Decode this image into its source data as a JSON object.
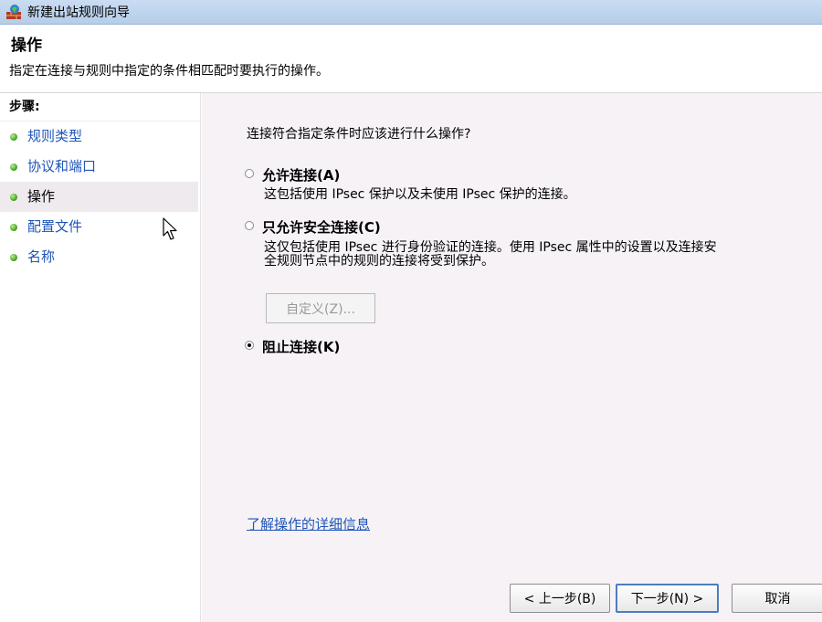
{
  "window": {
    "title": "新建出站规则向导"
  },
  "header": {
    "title": "操作",
    "subtitle": "指定在连接与规则中指定的条件相匹配时要执行的操作。"
  },
  "steps": {
    "label": "步骤:",
    "items": [
      {
        "label": "规则类型",
        "current": false
      },
      {
        "label": "协议和端口",
        "current": false
      },
      {
        "label": "操作",
        "current": true
      },
      {
        "label": "配置文件",
        "current": false
      },
      {
        "label": "名称",
        "current": false
      }
    ]
  },
  "content": {
    "question": "连接符合指定条件时应该进行什么操作?",
    "options": [
      {
        "label": "允许连接(A)",
        "desc": [
          "这包括使用 IPsec 保护以及未使用 IPsec 保护的连接。"
        ],
        "checked": false
      },
      {
        "label": "只允许安全连接(C)",
        "desc": [
          "这仅包括使用 IPsec 进行身份验证的连接。使用 IPsec 属性中的设置以及连接安",
          "全规则节点中的规则的连接将受到保护。"
        ],
        "checked": false
      },
      {
        "label": "阻止连接(K)",
        "desc": [],
        "checked": true
      }
    ],
    "customize_label": "自定义(Z)...",
    "learn_more": "了解操作的详细信息"
  },
  "buttons": {
    "back": "< 上一步(B)",
    "next": "下一步(N) >",
    "cancel": "取消"
  },
  "colors": {
    "link": "#1e55b8",
    "titlebar": "#c9dcf2",
    "content_bg": "#f6f2f6"
  }
}
